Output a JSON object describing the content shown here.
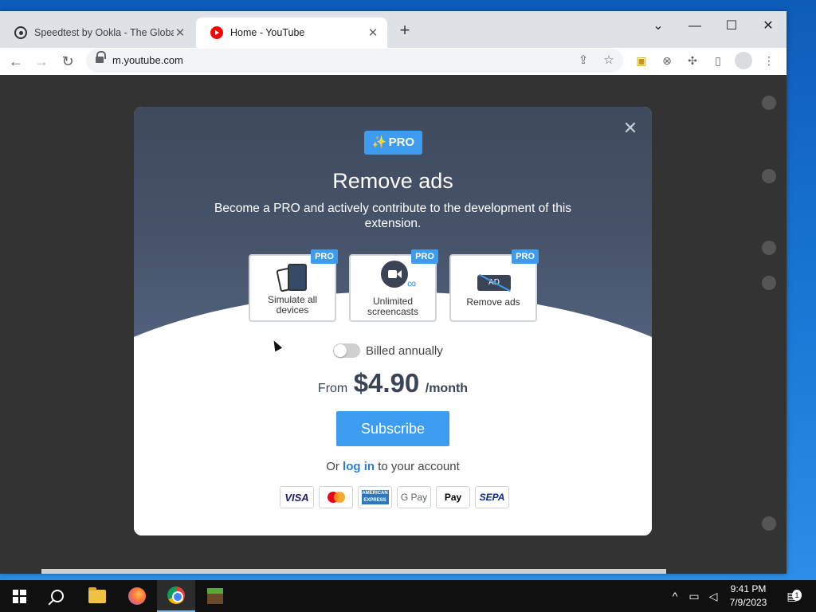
{
  "browser": {
    "tabs": [
      {
        "title": "Speedtest by Ookla - The Global",
        "close": "✕"
      },
      {
        "title": "Home - YouTube",
        "close": "✕"
      }
    ],
    "new_tab": "+",
    "window_controls": {
      "dropdown": "⌄",
      "minimize": "—",
      "maximize": "☐",
      "close": "✕"
    },
    "nav": {
      "back": "←",
      "forward": "→",
      "reload": "↻"
    },
    "url": "m.youtube.com",
    "toolbar_icons": {
      "share": "⇪",
      "bookmark": "☆",
      "extensions": "✣",
      "sidepanel": "▯",
      "menu": "⋮"
    }
  },
  "modal": {
    "close": "✕",
    "badge": {
      "icon": "✨",
      "label": "PRO"
    },
    "title": "Remove ads",
    "subtitle": "Become a PRO and actively contribute to the development of this extension.",
    "features": [
      {
        "tag": "PRO",
        "label": "Simulate all devices"
      },
      {
        "tag": "PRO",
        "label": "Unlimited screencasts"
      },
      {
        "tag": "PRO",
        "label": "Remove ads",
        "icon_text": "AD"
      }
    ],
    "billing": {
      "label": "Billed annually",
      "annual_enabled": false
    },
    "price": {
      "from": "From",
      "amount": "$4.90",
      "period": "/month"
    },
    "subscribe_label": "Subscribe",
    "login": {
      "prefix": "Or",
      "link": "log in",
      "suffix": "to your account"
    },
    "payment_methods": [
      "VISA",
      "Mastercard",
      "AMERICAN EXPRESS",
      "G Pay",
      " Pay",
      "SEPA"
    ],
    "colors": {
      "accent": "#3d9bf0",
      "header_bg": "#404a5d",
      "text_dark": "#3b4456"
    }
  },
  "taskbar": {
    "clock_time": "9:41 PM",
    "clock_date": "7/9/2023",
    "notification_count": "1",
    "tray": {
      "chevron": "^"
    }
  }
}
